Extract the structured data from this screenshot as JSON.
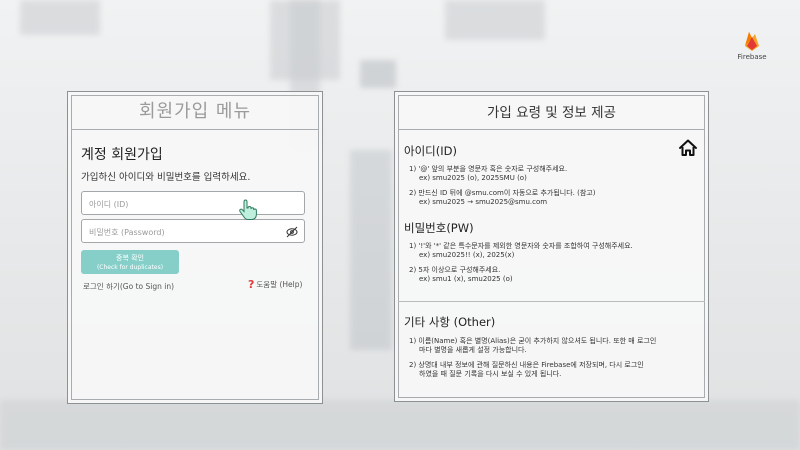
{
  "brand": {
    "logo_text": "Firebase",
    "accent": "#e8621d"
  },
  "signup_panel": {
    "title": "회원가입 메뉴",
    "subtitle": "계정 회원가입",
    "instruction": "가입하신 아이디와 비밀번호를 입력하세요.",
    "id_placeholder": "아이디 (ID)",
    "pw_placeholder": "비밀번호 (Password)",
    "dup_button": {
      "line1": "중복 확인",
      "line2": "(Check for duplicates)",
      "color": "#86cfc9"
    },
    "login_link": "로그인 하기(Go to Sign in)",
    "help_link": "도움말 (Help)",
    "icons": {
      "password_toggle": "eye-off-icon",
      "cursor": "hand-pointer-icon",
      "help": "question-mark-icon"
    }
  },
  "info_panel": {
    "title": "가입 요령 및 정보 제공",
    "id_section": {
      "heading": "아이디(ID)",
      "items": [
        {
          "text": "1) '@' 앞의 부분을 영문자 혹은 숫자로 구성해주세요.",
          "example": "ex) smu2025 (o), 2025SMU (o)"
        },
        {
          "text": "2) 만드신 ID 뒤에 @smu.com이 자동으로 추가됩니다. (참고)",
          "example": "ex) smu2025 → smu2025@smu.com"
        }
      ]
    },
    "pw_section": {
      "heading": "비밀번호(PW)",
      "items": [
        {
          "text": "1) '!'와 '*' 같은 특수문자를 제외한 영문자와 숫자를 조합하여 구성해주세요.",
          "example": "ex) smu2025!! (x), 2025(x)"
        },
        {
          "text": "2) 5자 이상으로 구성해주세요.",
          "example": "ex) smu1 (x), smu2025 (o)"
        }
      ]
    },
    "other_section": {
      "heading": "기타 사항 (Other)",
      "items": [
        {
          "text": "1) 이름(Name) 혹은 별명(Alias)은 굳이 추가하지 않으셔도 됩니다. 또한 매 로그인",
          "cont": "마다 별명을 새롭게 설정 가능합니다."
        },
        {
          "text": "2) 상명대 내부 정보에 관해 질문하신 내용은 Firebase에 저장되며, 다시 로그인",
          "cont": "하였을 때 질문 기록을 다시 보실 수 있게 됩니다."
        }
      ]
    },
    "home_icon": "home-icon"
  }
}
